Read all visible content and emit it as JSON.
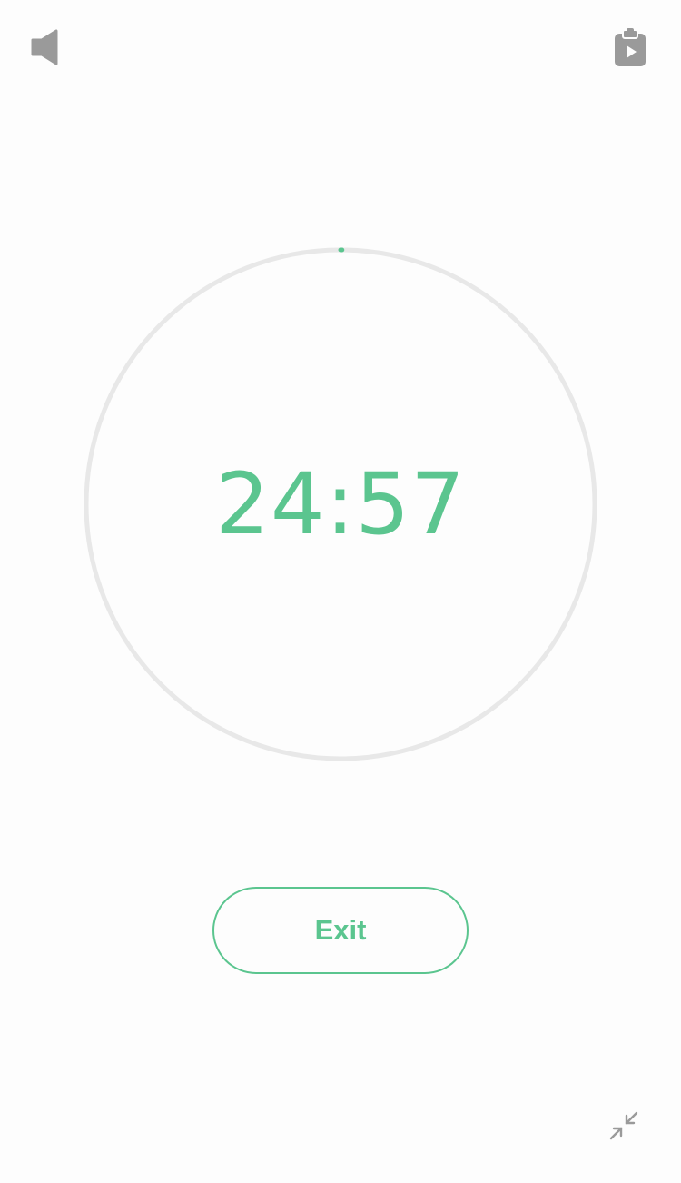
{
  "timer": {
    "display": "24:57",
    "progress": 0.002
  },
  "actions": {
    "exit_label": "Exit"
  },
  "icons": {
    "sound": "speaker-icon",
    "clipboard": "clipboard-play-icon",
    "shrink": "minimize-arrows-icon"
  },
  "colors": {
    "accent": "#5bc58f",
    "ring_track": "#e8e8e8",
    "icon_gray": "#9a9a9a",
    "background": "#fdfdfd"
  }
}
